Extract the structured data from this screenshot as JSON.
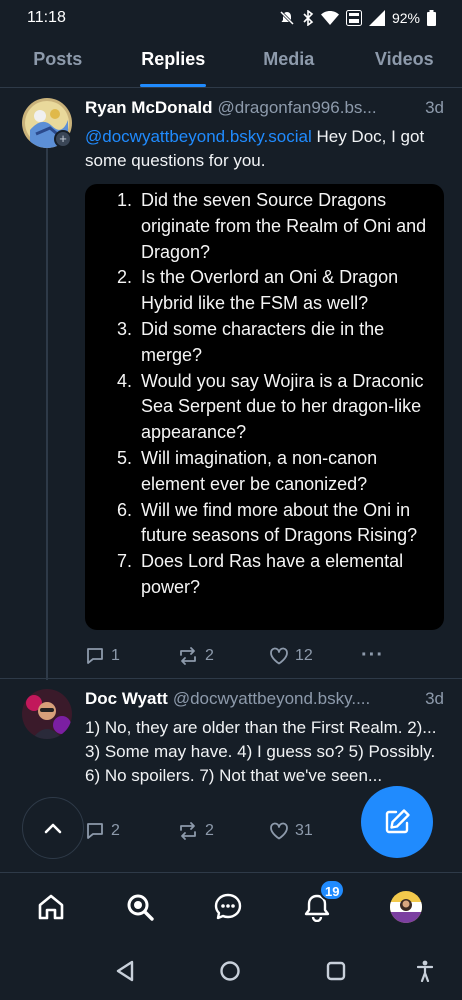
{
  "status_bar": {
    "time": "11:18",
    "battery": "92%",
    "icons": [
      "mute-icon",
      "bluetooth-icon",
      "wifi-icon",
      "volte-icon",
      "signal-icon",
      "battery-icon"
    ]
  },
  "tabs": [
    {
      "label": "Posts",
      "active": false
    },
    {
      "label": "Replies",
      "active": true
    },
    {
      "label": "Media",
      "active": false
    },
    {
      "label": "Videos",
      "active": false
    }
  ],
  "posts": [
    {
      "author": "Ryan McDonald",
      "handle": "@dragonfan996.bs...",
      "time": "3d",
      "mention": "@docwyattbeyond.bsky.social",
      "text": " Hey Doc, I got some questions for you.",
      "image_list": [
        {
          "num": "1.",
          "text": "Did the seven Source Dragons originate from the Realm of Oni and Dragon?"
        },
        {
          "num": "2.",
          "text": "Is the Overlord an Oni & Dragon Hybrid like the FSM as well?"
        },
        {
          "num": "3.",
          "text": "Did some characters die in the merge?"
        },
        {
          "num": "4.",
          "text": "Would you say Wojira is a Draconic Sea Serpent due to her dragon-like appearance?"
        },
        {
          "num": "5.",
          "text": "Will imagination, a non-canon element ever be canonized?"
        },
        {
          "num": "6.",
          "text": "Will we find more about the Oni in future seasons of Dragons Rising?"
        },
        {
          "num": "7.",
          "text": "Does Lord Ras have a elemental power?"
        }
      ],
      "replies": "1",
      "reposts": "2",
      "likes": "12",
      "more": "···"
    },
    {
      "author": "Doc Wyatt",
      "handle": "@docwyattbeyond.bsky....",
      "time": "3d",
      "text": "1) No, they are older than the First Realm. 2)... 3) Some may have. 4) I guess so? 5) Possibly. 6) No spoilers. 7) Not that we've seen...",
      "replies": "2",
      "reposts": "2",
      "likes": "31"
    }
  ],
  "bottom_nav": {
    "items": [
      "home-icon",
      "search-icon",
      "messages-icon",
      "notifications-icon",
      "profile-avatar"
    ],
    "notifications_badge": "19"
  },
  "colors": {
    "background": "#161e27",
    "accent": "#208bfe",
    "muted": "#8d9aab",
    "border": "#2e3a48"
  }
}
